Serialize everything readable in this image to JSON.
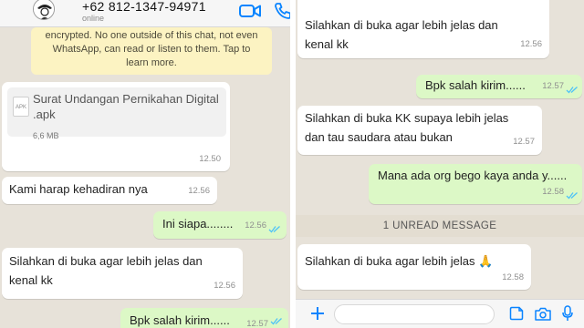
{
  "contact": {
    "phone": "+62 812-1347-94971",
    "status": "online"
  },
  "encryption_notice": "encrypted. No one outside of this chat, not even WhatsApp, can read or listen to them. Tap to learn more.",
  "left_messages": [
    {
      "type": "file",
      "direction": "incoming",
      "file_name": "Surat Undangan Pernikahan Digital .apk",
      "file_badge": "APK",
      "file_size": "6,6 MB",
      "time": "12.50"
    },
    {
      "type": "text",
      "direction": "incoming",
      "text": "Kami harap kehadiran nya",
      "time": "12.56"
    },
    {
      "type": "text",
      "direction": "outgoing",
      "text": "Ini siapa........",
      "time": "12.56"
    },
    {
      "type": "text",
      "direction": "incoming",
      "text_lines": [
        "Silahkan di buka agar lebih jelas dan",
        "kenal kk"
      ],
      "time": "12.56"
    },
    {
      "type": "text",
      "direction": "outgoing",
      "text": "Bpk salah kirim......",
      "time": "12.57"
    }
  ],
  "right_messages": [
    {
      "type": "text",
      "direction": "incoming",
      "text_lines": [
        "Silahkan di buka agar lebih jelas dan",
        "kenal kk"
      ],
      "time": "12.56"
    },
    {
      "type": "text",
      "direction": "outgoing",
      "text": "Bpk salah kirim......",
      "time": "12.57"
    },
    {
      "type": "text",
      "direction": "incoming",
      "text_lines": [
        "Silahkan di buka KK supaya lebih jelas",
        "dan tau saudara atau bukan"
      ],
      "time": "12.57"
    },
    {
      "type": "text",
      "direction": "outgoing",
      "text": "Mana ada org bego kaya anda y......",
      "time": "12.58"
    },
    {
      "type": "text",
      "direction": "incoming",
      "text": "Silahkan di buka agar lebih jelas 🙏",
      "time": "12.58"
    }
  ],
  "unread_banner": "1 UNREAD MESSAGE",
  "icons": {
    "video": "video-call-icon",
    "call": "phone-call-icon",
    "read_ticks": "double-check-icon",
    "attach": "plus-icon",
    "sticker": "sticker-icon",
    "camera": "camera-icon",
    "mic": "microphone-icon"
  },
  "colors": {
    "accent": "#0a84ff",
    "outgoing_bubble": "#dcf8c6",
    "incoming_bubble": "#ffffff",
    "chat_background": "#e7e2d9",
    "encryption_banner": "#fcf3c2",
    "read_ticks": "#4fc3f7"
  }
}
